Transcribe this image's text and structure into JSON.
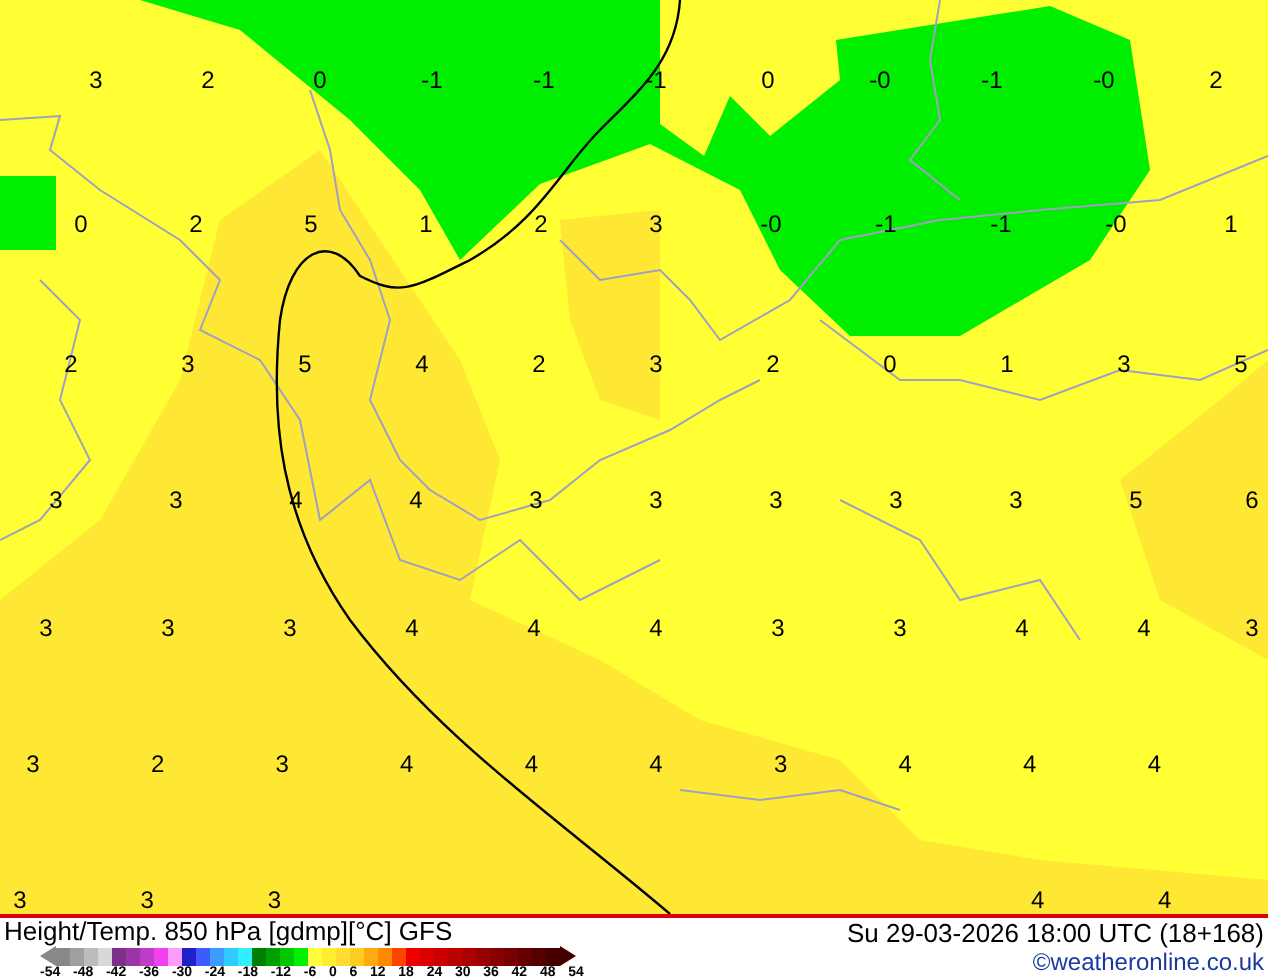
{
  "map": {
    "grid_labels": [
      [
        "3",
        "2",
        "0",
        "-1",
        "-1",
        "-1",
        "0",
        "-0",
        "-1",
        "-0",
        "2"
      ],
      [
        "0",
        "2",
        "5",
        "1",
        "2",
        "3",
        "-0",
        "-1",
        "-1",
        "-0",
        "1"
      ],
      [
        "2",
        "3",
        "5",
        "4",
        "2",
        "3",
        "2",
        "0",
        "1",
        "3",
        "5"
      ],
      [
        "3",
        "3",
        "4",
        "4",
        "3",
        "3",
        "3",
        "3",
        "3",
        "5",
        "6"
      ],
      [
        "3",
        "3",
        "3",
        "4",
        "4",
        "4",
        "3",
        "3",
        "4",
        "4",
        "3"
      ],
      [
        "3",
        "2",
        "3",
        "4",
        "4",
        "4",
        "3",
        "4",
        "4",
        "4"
      ],
      [
        "3",
        "3",
        "3"
      ]
    ],
    "bottom_right_labels": [
      "4",
      "4"
    ]
  },
  "footer": {
    "title": "Height/Temp. 850 hPa [gdmp][°C] GFS",
    "valid_time": "Su 29-03-2026 18:00 UTC (18+168)",
    "copyright_link": "©weatheronline.co.uk",
    "legend": {
      "ticks": [
        "-54",
        "-48",
        "-42",
        "-36",
        "-30",
        "-24",
        "-18",
        "-12",
        "-6",
        "0",
        "6",
        "12",
        "18",
        "24",
        "30",
        "36",
        "42",
        "48",
        "54"
      ]
    }
  }
}
